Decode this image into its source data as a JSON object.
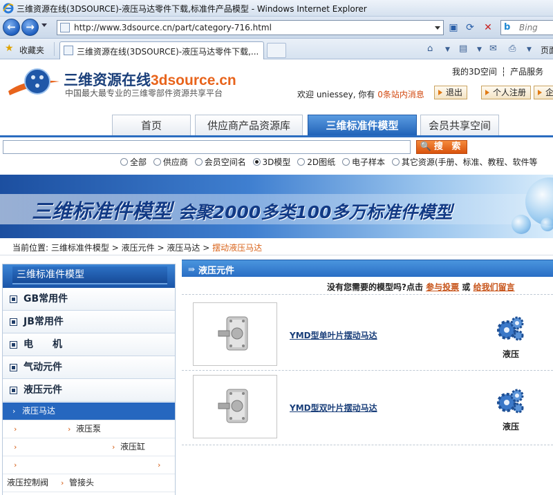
{
  "browser": {
    "window_title": "三维资源在线(3DSOURCE)-液压马达零件下载,标准件产品模型 - Windows Internet Explorer",
    "url": "http://www.3dsource.cn/part/category-716.html",
    "search_engine": "Bing",
    "favorites_label": "收藏夹",
    "tab_title": "三维资源在线(3DSOURCE)-液压马达零件下载,...",
    "command_label": "页面"
  },
  "header": {
    "logo_cn": "三维资源在线",
    "logo_en": "3dsource.cn",
    "slogan": "中国最大最专业的三维零部件资源共享平台",
    "top_links": [
      "我的3D空间",
      "┆",
      "产品服务"
    ],
    "welcome_prefix": "欢迎 uniessey, 你有",
    "welcome_msg": "0条站内消息",
    "buttons": [
      "退出",
      "个人注册",
      "企"
    ]
  },
  "nav": {
    "tabs": [
      "首页",
      "供应商产品资源库",
      "三维标准件模型",
      "会员共享空间"
    ],
    "active": 2
  },
  "search": {
    "button_label": "搜 索",
    "options": [
      "全部",
      "供应商",
      "会员空间名",
      "3D模型",
      "2D图纸",
      "电子样本",
      "其它资源(手册、标准、教程、软件等"
    ],
    "selected": 3
  },
  "banner": {
    "title_main": "三维标准件模型",
    "title_sub": " 会聚2000多类100多万标准件模型"
  },
  "breadcrumb": {
    "prefix": "当前位置:",
    "items": [
      "三维标准件模型",
      "液压元件",
      "液压马达"
    ],
    "current": "摆动液压马达",
    "sep": ">"
  },
  "sidebar": {
    "title": "三维标准件模型",
    "categories": [
      "GB常用件",
      "JB常用件",
      "电　　机",
      "气动元件",
      "液压元件"
    ],
    "sub_selected": "液压马达",
    "sub_rows": [
      {
        "a": "",
        "b": "液压泵"
      },
      {
        "a": "",
        "b": "液压缸"
      },
      {
        "a": "",
        "b": ""
      }
    ],
    "bottom_row": [
      "液压控制阀",
      "管接头"
    ]
  },
  "content": {
    "section_title": "液压元件",
    "ask_text": "没有您需要的模型吗?点击",
    "ask_link1": "参与投票",
    "ask_or": "或",
    "ask_link2": "给我们留言",
    "products": [
      {
        "name": "YMD型单叶片摆动马达",
        "category": "液压"
      },
      {
        "name": "YMD型双叶片摆动马达",
        "category": "液压"
      }
    ]
  },
  "colors": {
    "nav_active": "#2a6cc0",
    "accent_orange": "#d9631a",
    "link_blue": "#1a3f7a"
  }
}
